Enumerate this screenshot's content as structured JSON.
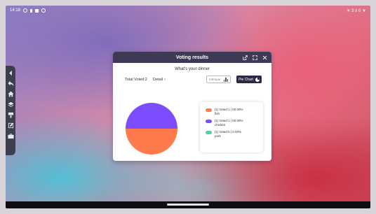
{
  "status_bar": {
    "time": "14:18",
    "right_text": "☀ 3 ¤ 0 ▼"
  },
  "sidebar": {
    "items": [
      {
        "icon": "collapse-icon"
      },
      {
        "icon": "back-icon"
      },
      {
        "icon": "home-icon"
      },
      {
        "icon": "layers-icon"
      },
      {
        "icon": "paint-icon"
      },
      {
        "icon": "edit-icon"
      },
      {
        "icon": "toolbox-icon"
      }
    ]
  },
  "dialog": {
    "title": "Voting results",
    "question": "What's your dinner",
    "total_voted": "Total Voted:2",
    "detail_label": "Detail",
    "detail_chevron": "›",
    "dropdown_placeholder": "mhrayar",
    "pie_button_label": "Pie Chart"
  },
  "chart_data": {
    "type": "pie",
    "categories": [
      "fish",
      "chicken",
      "pork"
    ],
    "values": [
      1,
      1,
      0
    ],
    "percent_labels": [
      "50.00%",
      "50.00%",
      "0.00%"
    ],
    "colors": [
      "#ff7a4d",
      "#7b4dff",
      "#4fd1a0"
    ],
    "legend": [
      {
        "line1": "[1] Voted:1 | 50.00%",
        "line2": "fish",
        "color": "#ff7a4d"
      },
      {
        "line1": "[1] Voted:1 | 50.00%",
        "line2": "chicken",
        "color": "#7b4dff"
      },
      {
        "line1": "[1] Voted:0 | 0.00%",
        "line2": "pork",
        "color": "#4fd1a0"
      }
    ]
  }
}
